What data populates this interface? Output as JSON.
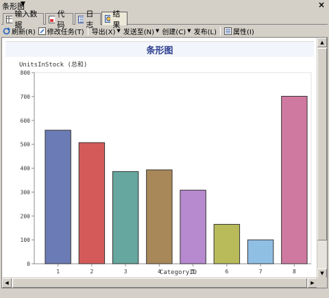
{
  "window": {
    "title": "条形图",
    "close_label": "×"
  },
  "tabs": [
    {
      "label": "输入数据",
      "icon": "table-icon"
    },
    {
      "label": "代码",
      "icon": "code-icon"
    },
    {
      "label": "日志",
      "icon": "log-icon"
    },
    {
      "label": "结果",
      "icon": "results-icon",
      "active": true
    }
  ],
  "toolbar": {
    "refresh": "刷新(R)",
    "modify_task": "修改任务(T)",
    "export": "导出(X)",
    "send_to": "发送至(N)",
    "create": "创建(C)",
    "publish": "发布(L)",
    "properties": "属性(I)"
  },
  "colors": {
    "accent": "#2c3e8f",
    "bars": [
      "#6b7bb5",
      "#d45a5a",
      "#66a79f",
      "#a88858",
      "#b78ad0",
      "#b9bb5b",
      "#90bfe4",
      "#cf79a0"
    ]
  },
  "chart_data": {
    "type": "bar",
    "title": "条形图",
    "ylabel": "UnitsInStock (总和)",
    "xlabel": "CategoryID",
    "categories": [
      "1",
      "2",
      "3",
      "4",
      "5",
      "6",
      "7",
      "8"
    ],
    "values": [
      559,
      507,
      386,
      393,
      308,
      165,
      100,
      701
    ],
    "ylim": [
      0,
      800
    ],
    "yticks": [
      0,
      100,
      200,
      300,
      400,
      500,
      600,
      700,
      800
    ],
    "grid": false,
    "legend": "none"
  }
}
